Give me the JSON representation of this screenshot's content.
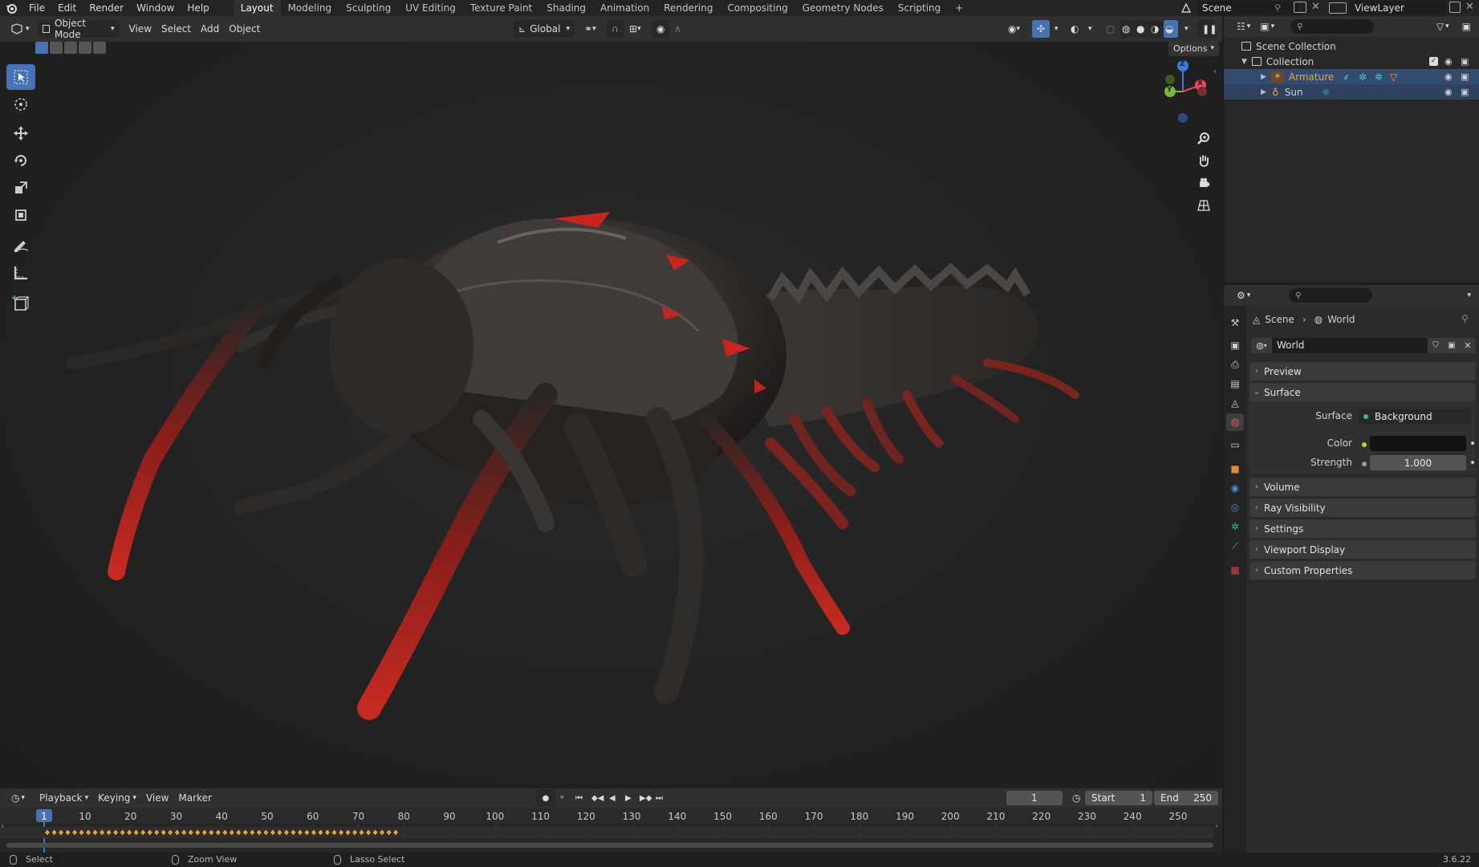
{
  "menu": {
    "file": "File",
    "edit": "Edit",
    "render": "Render",
    "window": "Window",
    "help": "Help"
  },
  "workspaces": [
    "Layout",
    "Modeling",
    "Sculpting",
    "UV Editing",
    "Texture Paint",
    "Shading",
    "Animation",
    "Rendering",
    "Compositing",
    "Geometry Nodes",
    "Scripting"
  ],
  "add_workspace": "+",
  "scene_name": "Scene",
  "view_layer": "ViewLayer",
  "viewport_header": {
    "mode": "Object Mode",
    "view": "View",
    "select": "Select",
    "add": "Add",
    "object": "Object",
    "orientation": "Global",
    "options": "Options"
  },
  "gizmo": {
    "z": "Z",
    "x": "X",
    "y": "Y"
  },
  "outliner": {
    "scene_collection": "Scene Collection",
    "collection": "Collection",
    "items": [
      {
        "label": "Armature"
      },
      {
        "label": "Sun"
      }
    ]
  },
  "properties": {
    "breadcrumb_scene": "Scene",
    "breadcrumb_world": "World",
    "world_name": "World",
    "panels": {
      "preview": "Preview",
      "surface": "Surface",
      "volume": "Volume",
      "ray_visibility": "Ray Visibility",
      "settings": "Settings",
      "viewport_display": "Viewport Display",
      "custom_properties": "Custom Properties"
    },
    "surface_label": "Surface",
    "surface_value": "Background",
    "color_label": "Color",
    "strength_label": "Strength",
    "strength_value": "1.000"
  },
  "timeline": {
    "playback": "Playback",
    "keying": "Keying",
    "view": "View",
    "marker": "Marker",
    "current_frame": "1",
    "start_label": "Start",
    "start_value": "1",
    "end_label": "End",
    "end_value": "250",
    "ticks": [
      "1",
      "10",
      "20",
      "30",
      "40",
      "50",
      "60",
      "70",
      "80",
      "90",
      "100",
      "110",
      "120",
      "130",
      "140",
      "150",
      "160",
      "170",
      "180",
      "190",
      "200",
      "210",
      "220",
      "230",
      "240",
      "250"
    ]
  },
  "status": {
    "select": "Select",
    "zoom": "Zoom View",
    "lasso": "Lasso Select",
    "version": "3.6.22"
  },
  "colors": {
    "accent": "#4772b3",
    "armature_text": "#e8a43c",
    "creature_red": "#b8241f"
  }
}
